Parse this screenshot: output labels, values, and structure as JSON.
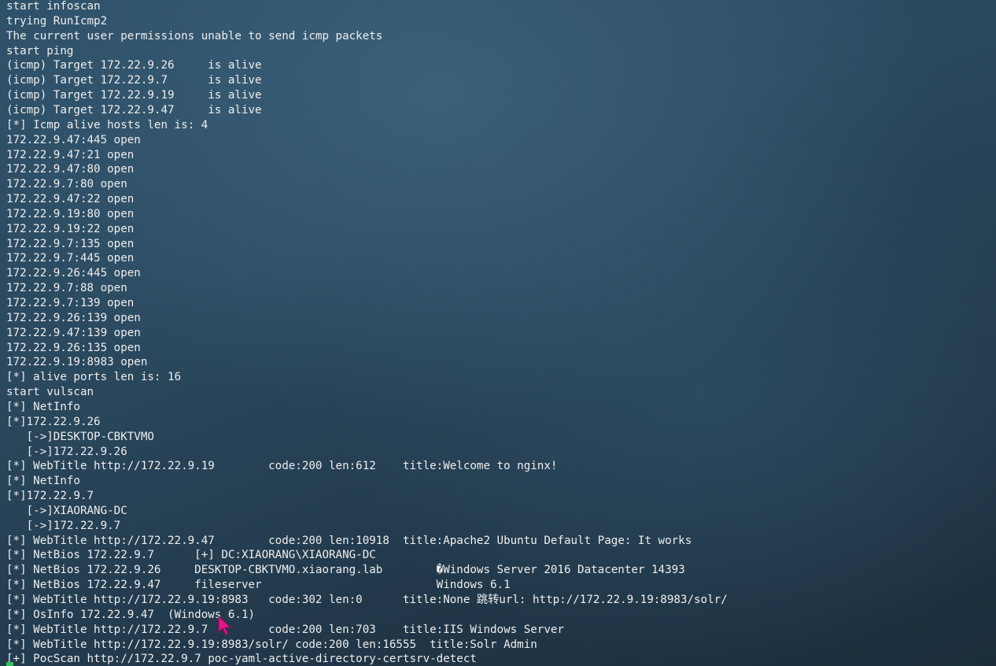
{
  "terminal": {
    "lines": [
      "start infoscan",
      "trying RunIcmp2",
      "The current user permissions unable to send icmp packets",
      "start ping",
      "(icmp) Target 172.22.9.26     is alive",
      "(icmp) Target 172.22.9.7      is alive",
      "(icmp) Target 172.22.9.19     is alive",
      "(icmp) Target 172.22.9.47     is alive",
      "[*] Icmp alive hosts len is: 4",
      "172.22.9.47:445 open",
      "172.22.9.47:21 open",
      "172.22.9.47:80 open",
      "172.22.9.7:80 open",
      "172.22.9.47:22 open",
      "172.22.9.19:80 open",
      "172.22.9.19:22 open",
      "172.22.9.7:135 open",
      "172.22.9.7:445 open",
      "172.22.9.26:445 open",
      "172.22.9.7:88 open",
      "172.22.9.7:139 open",
      "172.22.9.26:139 open",
      "172.22.9.47:139 open",
      "172.22.9.26:135 open",
      "172.22.9.19:8983 open",
      "[*] alive ports len is: 16",
      "start vulscan",
      "[*] NetInfo",
      "[*]172.22.9.26",
      "   [->]DESKTOP-CBKTVMO",
      "   [->]172.22.9.26",
      "[*] WebTitle http://172.22.9.19        code:200 len:612    title:Welcome to nginx!",
      "[*] NetInfo",
      "[*]172.22.9.7",
      "   [->]XIAORANG-DC",
      "   [->]172.22.9.7",
      "[*] WebTitle http://172.22.9.47        code:200 len:10918  title:Apache2 Ubuntu Default Page: It works",
      "[*] NetBios 172.22.9.7      [+] DC:XIAORANG\\XIAORANG-DC",
      "[*] NetBios 172.22.9.26     DESKTOP-CBKTVMO.xiaorang.lab        �Windows Server 2016 Datacenter 14393",
      "[*] NetBios 172.22.9.47     fileserver                          Windows 6.1",
      "[*] WebTitle http://172.22.9.19:8983   code:302 len:0      title:None 跳转url: http://172.22.9.19:8983/solr/",
      "[*] OsInfo 172.22.9.47  (Windows 6.1)",
      "[*] WebTitle http://172.22.9.7         code:200 len:703    title:IIS Windows Server",
      "[*] WebTitle http://172.22.9.19:8983/solr/ code:200 len:16555  title:Solr Admin",
      "[+] PocScan http://172.22.9.7 poc-yaml-active-directory-certsrv-detect"
    ]
  },
  "colors": {
    "text": "#eeeeee",
    "cursor": "#2ec45a",
    "pointer": "#e8148c"
  },
  "icons": {
    "mouse_pointer": "arrow-pointer-icon"
  }
}
